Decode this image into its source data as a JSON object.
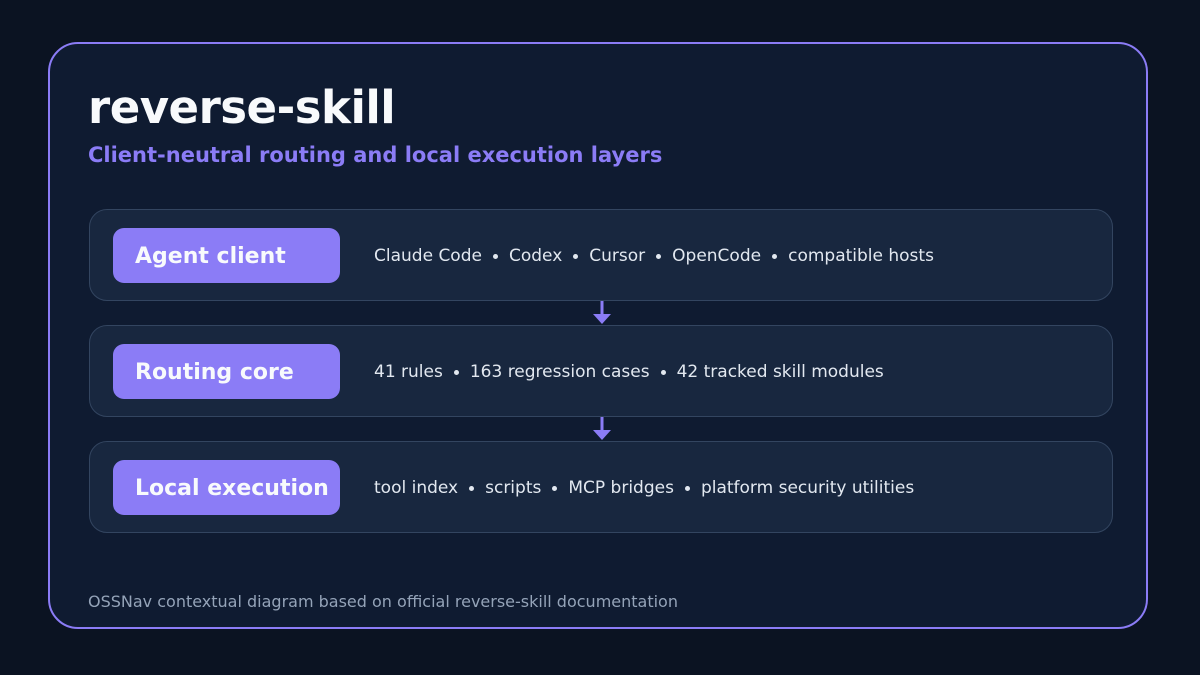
{
  "title": "reverse-skill",
  "subtitle": "Client-neutral routing and local execution layers",
  "layers": [
    {
      "label": "Agent client",
      "items": [
        "Claude Code",
        "Codex",
        "Cursor",
        "OpenCode",
        "compatible hosts"
      ]
    },
    {
      "label": "Routing core",
      "items": [
        "41 rules",
        "163 regression cases",
        "42 tracked skill modules"
      ]
    },
    {
      "label": "Local execution",
      "items": [
        "tool index",
        "scripts",
        "MCP bridges",
        "platform security utilities"
      ]
    }
  ],
  "footer": "OSSNav contextual diagram based on official reverse-skill documentation",
  "colors": {
    "background": "#0b1322",
    "card": "#0f1b31",
    "accent": "#8b7cf6",
    "layer_fill": "#18273f",
    "layer_border": "#334560",
    "text": "#e2e8f0",
    "muted": "#94a3b8"
  },
  "icons": {
    "connector": "arrow-down-icon"
  }
}
